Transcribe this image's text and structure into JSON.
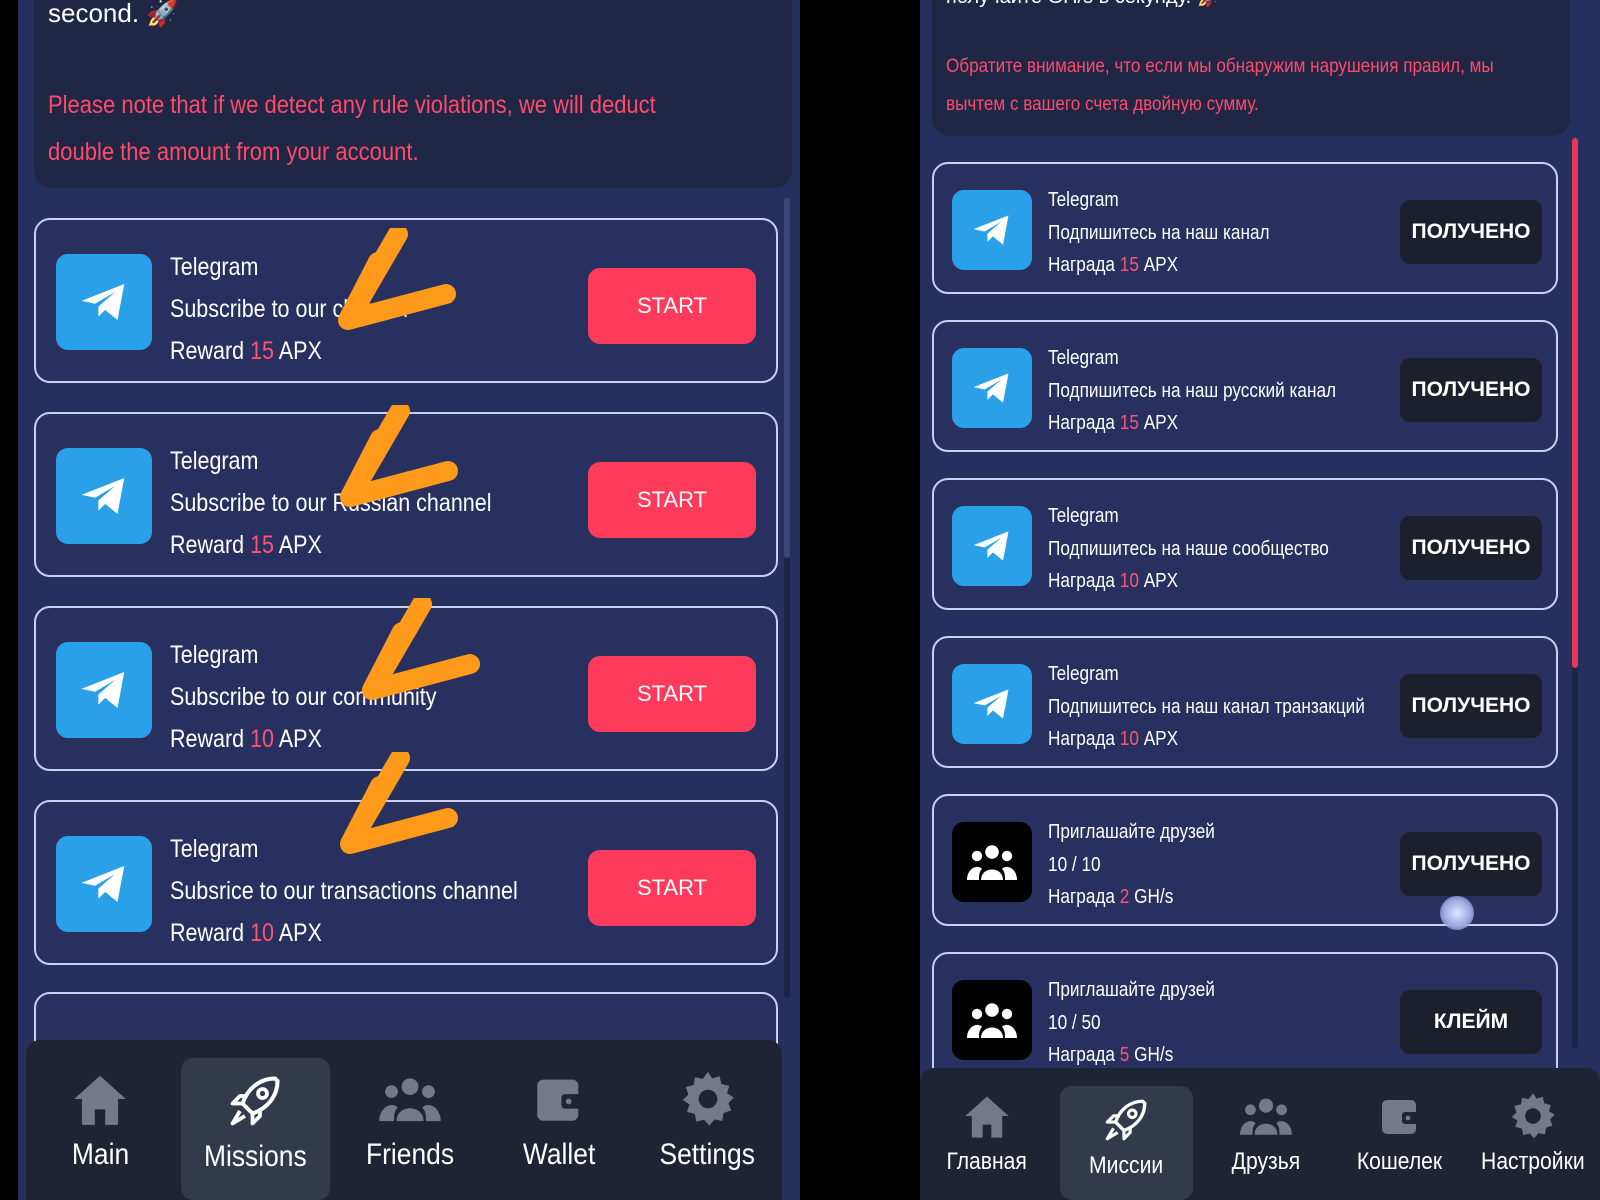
{
  "left": {
    "notice": {
      "lead": "second. 🚀",
      "warning": "Please note that if we detect any rule violations, we will deduct double the amount from your account."
    },
    "missions": [
      {
        "source": "Telegram",
        "title": "Subscribe to our channel",
        "reward_label": "Reward",
        "reward_value": "15",
        "reward_unit": "APX",
        "button": "START"
      },
      {
        "source": "Telegram",
        "title": "Subscribe to our Russian channel",
        "reward_label": "Reward",
        "reward_value": "15",
        "reward_unit": "APX",
        "button": "START"
      },
      {
        "source": "Telegram",
        "title": "Subscribe to our community",
        "reward_label": "Reward",
        "reward_value": "10",
        "reward_unit": "APX",
        "button": "START"
      },
      {
        "source": "Telegram",
        "title": "Subsrice to our transactions channel",
        "reward_label": "Reward",
        "reward_value": "10",
        "reward_unit": "APX",
        "button": "START"
      }
    ],
    "nav": [
      {
        "label": "Main",
        "icon": "home-icon"
      },
      {
        "label": "Missions",
        "icon": "rocket-icon",
        "active": true
      },
      {
        "label": "Friends",
        "icon": "friends-icon"
      },
      {
        "label": "Wallet",
        "icon": "wallet-icon"
      },
      {
        "label": "Settings",
        "icon": "gear-icon"
      }
    ]
  },
  "right": {
    "notice": {
      "lead": "получайте GH/s в секунду. 🚀",
      "warning": "Обратите внимание, что если мы обнаружим нарушения правил, мы вычтем с вашего счета двойную сумму."
    },
    "missions": [
      {
        "source": "Telegram",
        "title": "Подпишитесь на наш канал",
        "reward_label": "Награда",
        "reward_value": "15",
        "reward_unit": "APX",
        "button": "ПОЛУЧЕНО",
        "icon": "telegram-icon"
      },
      {
        "source": "Telegram",
        "title": "Подпишитесь на наш русский канал",
        "reward_label": "Награда",
        "reward_value": "15",
        "reward_unit": "APX",
        "button": "ПОЛУЧЕНО",
        "icon": "telegram-icon"
      },
      {
        "source": "Telegram",
        "title": "Подпишитесь на наше сообщество",
        "reward_label": "Награда",
        "reward_value": "10",
        "reward_unit": "APX",
        "button": "ПОЛУЧЕНО",
        "icon": "telegram-icon"
      },
      {
        "source": "Telegram",
        "title": "Подпишитесь на наш канал транзакций",
        "reward_label": "Награда",
        "reward_value": "10",
        "reward_unit": "APX",
        "button": "ПОЛУЧЕНО",
        "icon": "telegram-icon"
      },
      {
        "source": "Приглашайте друзей",
        "title": "10 / 10",
        "reward_label": "Награда",
        "reward_value": "2",
        "reward_unit": "GH/s",
        "button": "ПОЛУЧЕНО",
        "icon": "friends-icon"
      },
      {
        "source": "Приглашайте друзей",
        "title": "10 / 50",
        "reward_label": "Награда",
        "reward_value": "5",
        "reward_unit": "GH/s",
        "button": "КЛЕЙМ",
        "icon": "friends-icon"
      }
    ],
    "nav": [
      {
        "label": "Главная",
        "icon": "home-icon"
      },
      {
        "label": "Миссии",
        "icon": "rocket-icon",
        "active": true
      },
      {
        "label": "Друзья",
        "icon": "friends-icon"
      },
      {
        "label": "Кошелек",
        "icon": "wallet-icon"
      },
      {
        "label": "Настройки",
        "icon": "gear-icon"
      }
    ]
  },
  "colors": {
    "background": "#26305e",
    "card_border": "#c9cff0",
    "start_button": "#ff3b5c",
    "claimed_button": "#1c1f2c",
    "warning_text": "#ff4a6c",
    "reward_number": "#ff5277",
    "telegram": "#2aa0e8",
    "annotation_arrow": "#ff9a1a"
  }
}
